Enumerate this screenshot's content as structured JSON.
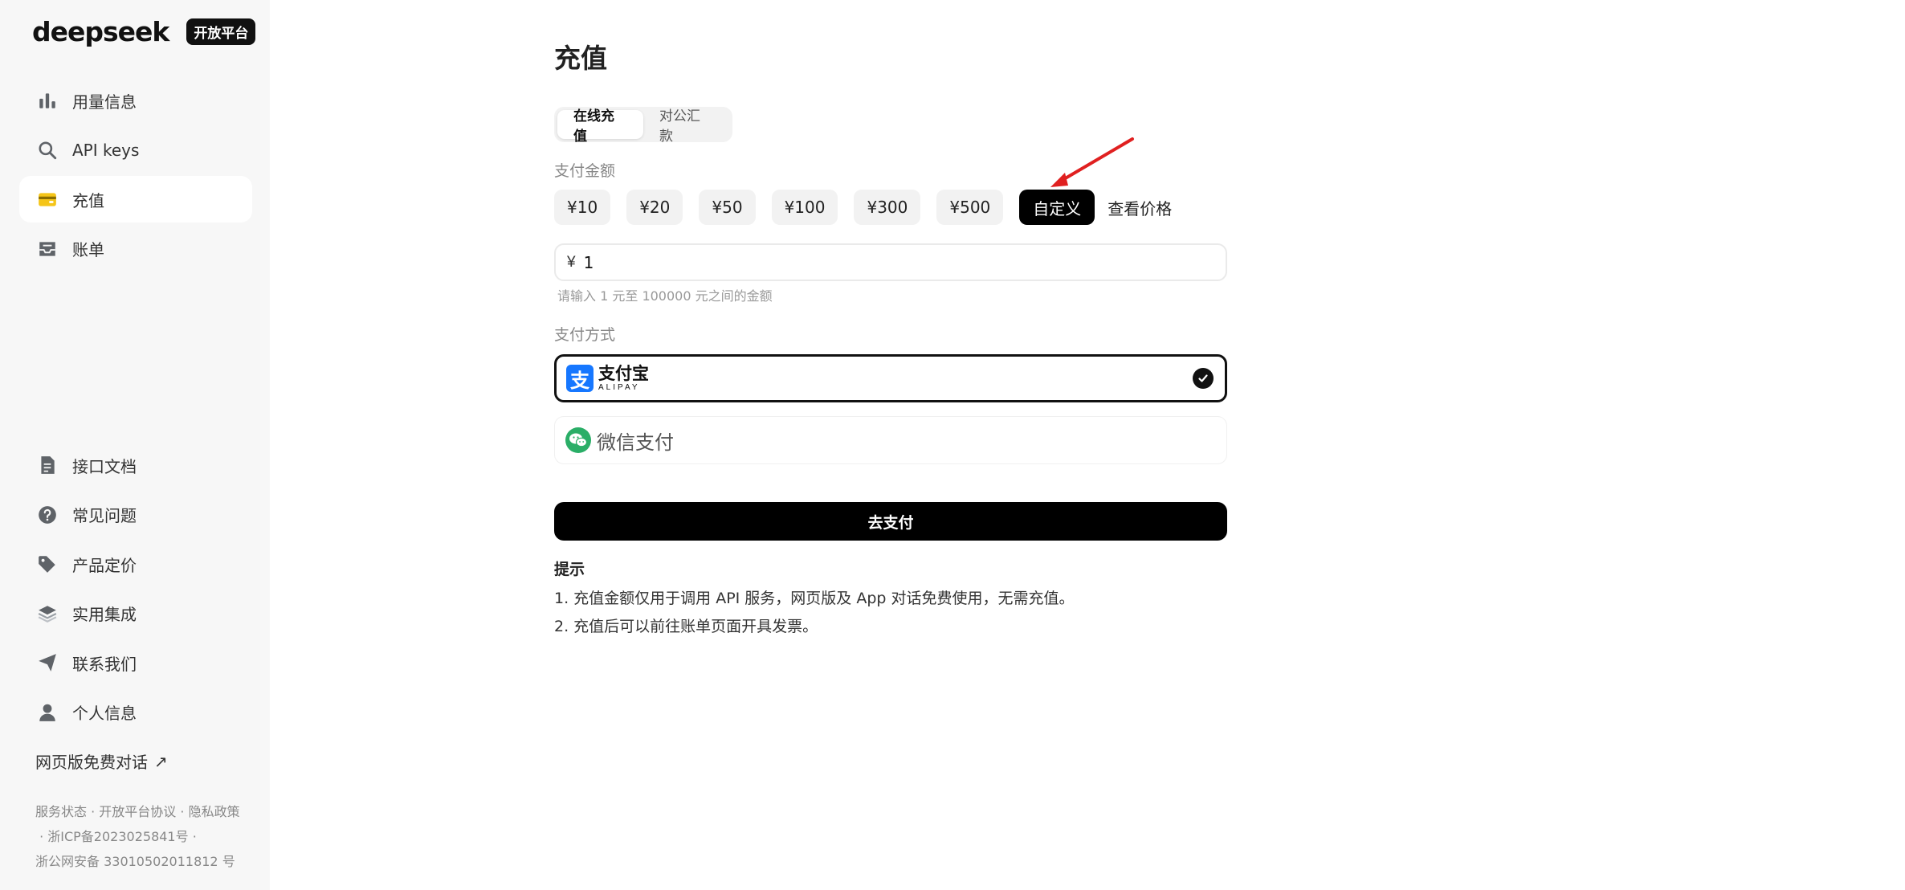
{
  "brand": {
    "name": "deepseek",
    "badge": "开放平台"
  },
  "sidebar": {
    "top_items": [
      {
        "label": "用量信息",
        "icon": "bar-chart-icon"
      },
      {
        "label": "API keys",
        "icon": "search-icon"
      },
      {
        "label": "充值",
        "icon": "wallet-icon",
        "active": true
      },
      {
        "label": "账单",
        "icon": "inbox-icon"
      }
    ],
    "bottom_items": [
      {
        "label": "接口文档",
        "icon": "document-icon"
      },
      {
        "label": "常见问题",
        "icon": "question-icon"
      },
      {
        "label": "产品定价",
        "icon": "tag-icon"
      },
      {
        "label": "实用集成",
        "icon": "layers-icon"
      },
      {
        "label": "联系我们",
        "icon": "send-icon"
      },
      {
        "label": "个人信息",
        "icon": "user-icon"
      }
    ],
    "web_chat": "网页版免费对话",
    "footer": {
      "service_status": "服务状态",
      "agreement": "开放平台协议",
      "privacy": "隐私政策",
      "icp": "浙ICP备2023025841号",
      "police": "浙公网安备 33010502011812 号"
    }
  },
  "main": {
    "title": "充值",
    "tabs": [
      {
        "label": "在线充值",
        "active": true
      },
      {
        "label": "对公汇款",
        "active": false
      }
    ],
    "amount_label": "支付金额",
    "amounts": [
      "¥10",
      "¥20",
      "¥50",
      "¥100",
      "¥300",
      "¥500"
    ],
    "custom_label": "自定义",
    "view_price": "查看价格",
    "currency_symbol": "¥",
    "amount_value": "1",
    "amount_hint": "请输入 1 元至 100000 元之间的金额",
    "method_label": "支付方式",
    "alipay": {
      "cn": "支付宝",
      "en": "ALIPAY"
    },
    "wechat": {
      "label": "微信支付"
    },
    "pay_button": "去支付",
    "tips_title": "提示",
    "tips": [
      "1. 充值金额仅用于调用 API 服务，网页版及 App 对话免费使用，无需充值。",
      "2. 充值后可以前往账单页面开具发票。"
    ]
  },
  "colors": {
    "accent": "#000000",
    "wallet": "#f5c518",
    "alipay": "#1677ff",
    "wechat": "#2aae67",
    "annotation": "#e02020"
  }
}
